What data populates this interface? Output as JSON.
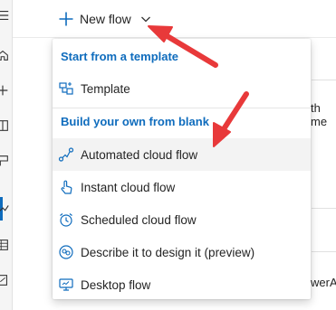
{
  "commandbar": {
    "new_flow_label": "New flow"
  },
  "rail": {
    "icons": [
      "menu-icon",
      "home-icon",
      "add-icon",
      "book-icon",
      "template-icon",
      "flow-icon",
      "table-icon",
      "document-icon"
    ]
  },
  "menu": {
    "section_template": "Start from a template",
    "template_item": "Template",
    "section_build": "Build your own from blank",
    "items": [
      {
        "label": "Automated cloud flow",
        "icon": "automated-flow-icon"
      },
      {
        "label": "Instant cloud flow",
        "icon": "touch-icon"
      },
      {
        "label": "Scheduled cloud flow",
        "icon": "clock-icon"
      },
      {
        "label": "Describe it to design it (preview)",
        "icon": "copilot-icon"
      },
      {
        "label": "Desktop flow",
        "icon": "desktop-icon"
      }
    ],
    "hovered_item": "Automated cloud flow"
  },
  "background": {
    "text_1": "th me",
    "text_2": "werA"
  },
  "colors": {
    "accent": "#0f6cbd",
    "arrow": "#e8393a",
    "hover": "#f3f3f3"
  }
}
